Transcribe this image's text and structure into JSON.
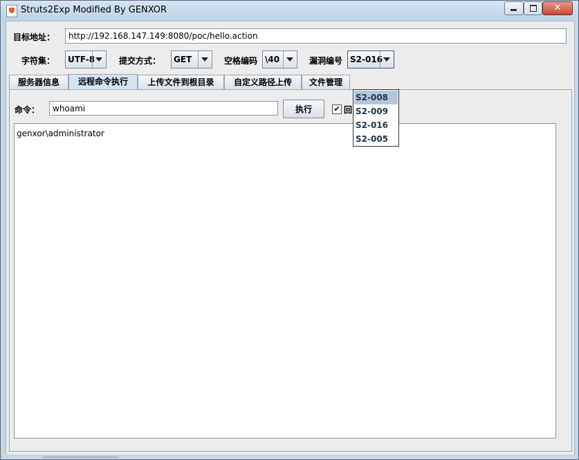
{
  "window": {
    "title": "Struts2Exp Modified By GENXOR"
  },
  "titlebar_buttons": {
    "minimize_icon": "minimize-icon",
    "maximize_icon": "maximize-icon",
    "close_icon": "close-icon",
    "close_glyph": "✕"
  },
  "form": {
    "target_label": "目标地址：",
    "target_value": "http://192.168.147.149:8080/poc/hello.action",
    "charset_label": "字符集：",
    "charset_value": "UTF-8",
    "method_label": "提交方式：",
    "method_value": "GET",
    "space_label": "空格编码",
    "space_value": "\\40",
    "vuln_label": "漏洞编号",
    "vuln_value": "S2-016"
  },
  "vuln_dropdown": {
    "options": [
      "S2-008",
      "S2-009",
      "S2-016",
      "S2-005"
    ],
    "highlighted": "S2-008"
  },
  "tabs": [
    {
      "label": "服务器信息"
    },
    {
      "label": "远程命令执行"
    },
    {
      "label": "上传文件到根目录"
    },
    {
      "label": "自定义路径上传"
    },
    {
      "label": "文件管理"
    }
  ],
  "active_tab": "远程命令执行",
  "command": {
    "label": "命令：",
    "value": "whoami",
    "execute_button": "执行",
    "echo_checkbox_checked": true,
    "echo_label_partial": "回"
  },
  "output": {
    "text": "genxor\\administrator"
  },
  "colors": {
    "titlebar": "#c7d6e6",
    "close_button": "#c44a37",
    "dropdown_highlight": "#b4c6da",
    "active_tab": "#d4e4f5"
  }
}
